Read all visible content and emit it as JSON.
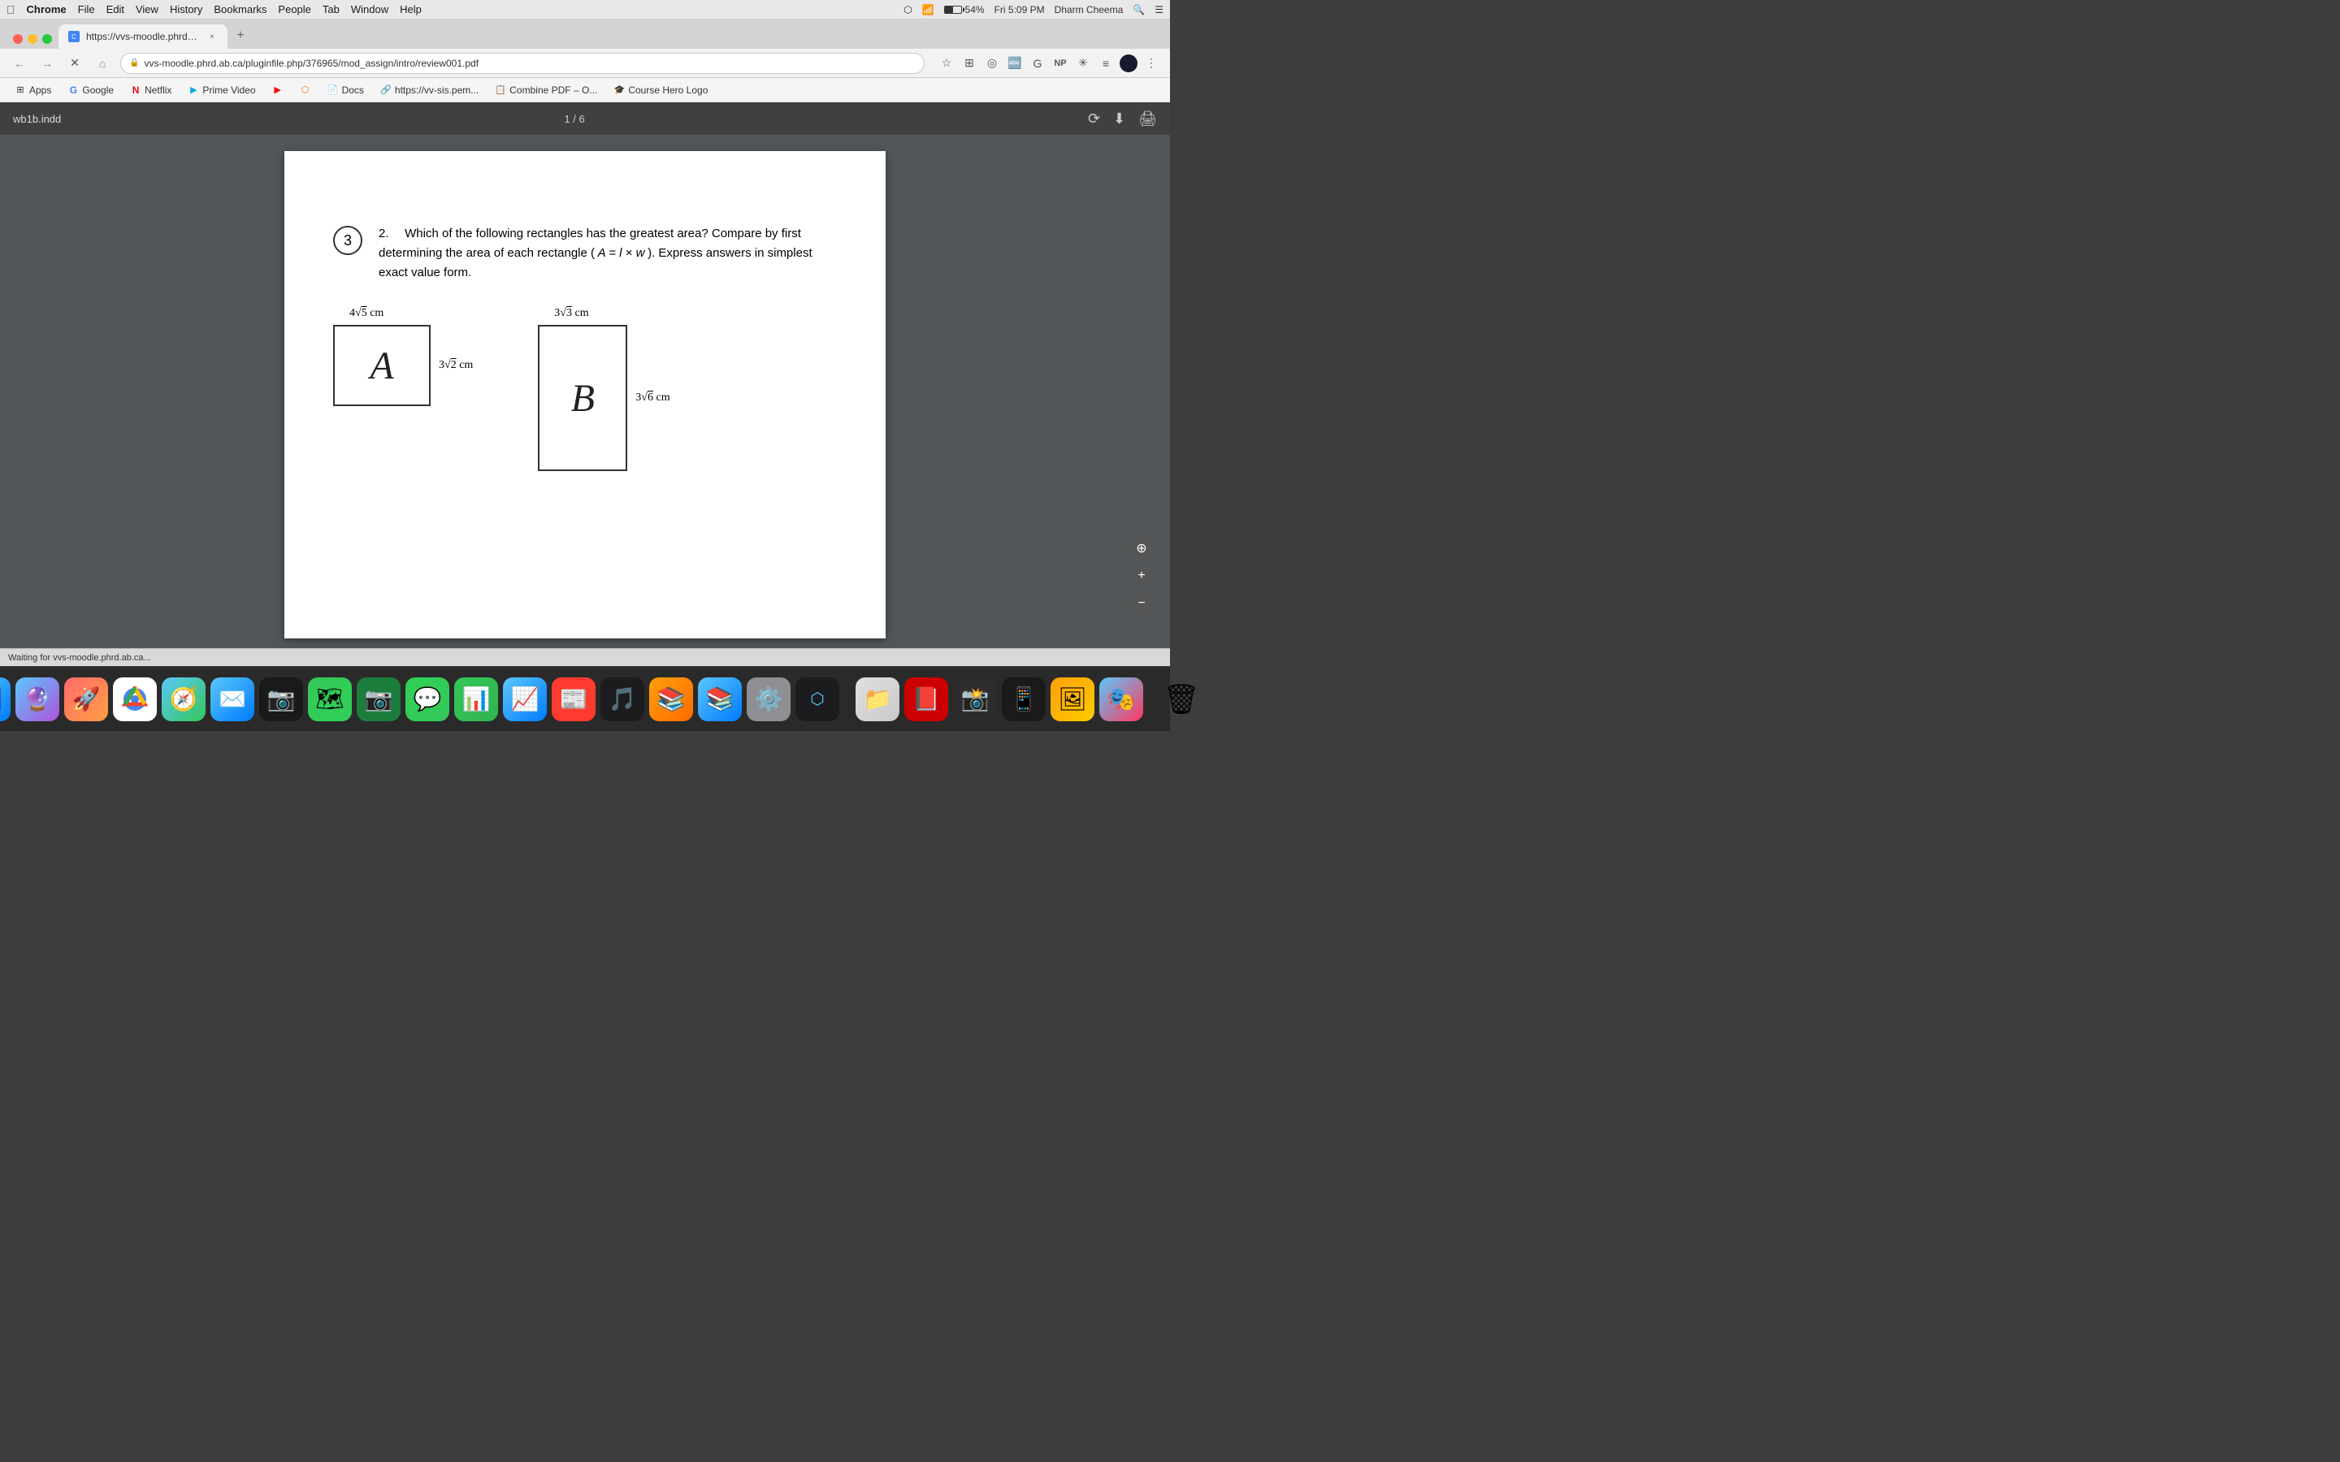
{
  "menubar": {
    "apple": "⌘",
    "items": [
      "Chrome",
      "File",
      "Edit",
      "View",
      "History",
      "Bookmarks",
      "People",
      "Tab",
      "Window",
      "Help"
    ],
    "right": {
      "bluetooth": "⌘",
      "wifi": "WiFi",
      "battery": "54%",
      "time": "Fri 5:09 PM",
      "user": "Dharm Cheema"
    }
  },
  "browser": {
    "tab_title": "https://vvs-moodle.phrd.ab.ca...",
    "url": "vvs-moodle.phrd.ab.ca/pluginfile.php/376965/mod_assign/intro/review001.pdf",
    "url_full": "https://vvs-moodle.phrd.ab.ca/pluginfile.php/376965/mod_assign/intro/review001.pdf"
  },
  "bookmarks": [
    {
      "id": "apps",
      "label": "Apps",
      "icon": "⋮⋮"
    },
    {
      "id": "google",
      "label": "Google",
      "icon": "G"
    },
    {
      "id": "netflix",
      "label": "Netflix",
      "icon": "N"
    },
    {
      "id": "prime",
      "label": "Prime Video",
      "icon": "P"
    },
    {
      "id": "youtube",
      "label": "",
      "icon": "▶"
    },
    {
      "id": "bookmk",
      "label": "",
      "icon": "B"
    },
    {
      "id": "docs",
      "label": "Docs",
      "icon": "📄"
    },
    {
      "id": "vv-sis",
      "label": "https://vv-sis.pem...",
      "icon": "🔗"
    },
    {
      "id": "combine",
      "label": "Combine PDF – O...",
      "icon": "📋"
    },
    {
      "id": "coursehero",
      "label": "Course Hero Logo",
      "icon": "🎓"
    }
  ],
  "pdf": {
    "filename": "wb1b.indd",
    "pagination": "1 / 6",
    "status_text": "Waiting for vvs-moodle.phrd.ab.ca..."
  },
  "content": {
    "circle_number": "3",
    "question_number": "2.",
    "question_text": "Which of the following rectangles has the greatest area?  Compare by first determining the area of each rectangle (",
    "question_formula": "A = l × w",
    "question_text2": ").  Express answers in simplest exact value form.",
    "rect_a": {
      "label": "A",
      "top_label": "4√5 cm",
      "side_label": "3√2 cm"
    },
    "rect_b": {
      "label": "B",
      "top_label": "3√3 cm",
      "side_label": "3√6 cm"
    }
  },
  "zoom_buttons": {
    "fit": "⊕",
    "plus": "+",
    "minus": "−"
  },
  "dock": {
    "items": [
      {
        "id": "finder",
        "icon": "🗂",
        "label": "Finder"
      },
      {
        "id": "siri",
        "icon": "🔮",
        "label": "Siri"
      },
      {
        "id": "launchpad",
        "icon": "🚀",
        "label": "Launchpad"
      },
      {
        "id": "chrome",
        "icon": "🌐",
        "label": "Chrome"
      },
      {
        "id": "safari",
        "icon": "🧭",
        "label": "Safari"
      },
      {
        "id": "mail",
        "icon": "✉️",
        "label": "Mail"
      },
      {
        "id": "photos",
        "icon": "🖼",
        "label": "Photos"
      },
      {
        "id": "maps",
        "icon": "🗺",
        "label": "Maps"
      },
      {
        "id": "photos2",
        "icon": "📷",
        "label": "Photos"
      },
      {
        "id": "facetime",
        "icon": "📹",
        "label": "FaceTime"
      },
      {
        "id": "messages",
        "icon": "💬",
        "label": "Messages"
      },
      {
        "id": "numbers",
        "icon": "📊",
        "label": "Numbers"
      },
      {
        "id": "numbers2",
        "icon": "📈",
        "label": "Numbers"
      },
      {
        "id": "news",
        "icon": "📰",
        "label": "News"
      },
      {
        "id": "music",
        "icon": "🎵",
        "label": "Music"
      },
      {
        "id": "books",
        "icon": "📚",
        "label": "Books"
      },
      {
        "id": "appstore",
        "icon": "🅐",
        "label": "App Store"
      },
      {
        "id": "systemprefs",
        "icon": "⚙️",
        "label": "System Preferences"
      },
      {
        "id": "bluetooth",
        "icon": "⬡",
        "label": "Bluetooth"
      },
      {
        "id": "finder2",
        "icon": "📁",
        "label": "Finder"
      },
      {
        "id": "acrobat",
        "icon": "📕",
        "label": "Acrobat"
      },
      {
        "id": "iphoto",
        "icon": "📸",
        "label": "iPhoto"
      },
      {
        "id": "iphone",
        "icon": "📱",
        "label": "iPhone"
      },
      {
        "id": "preview",
        "icon": "🖼",
        "label": "Preview"
      },
      {
        "id": "keynote",
        "icon": "🎭",
        "label": "Keynote"
      },
      {
        "id": "trash",
        "icon": "🗑",
        "label": "Trash"
      }
    ]
  }
}
